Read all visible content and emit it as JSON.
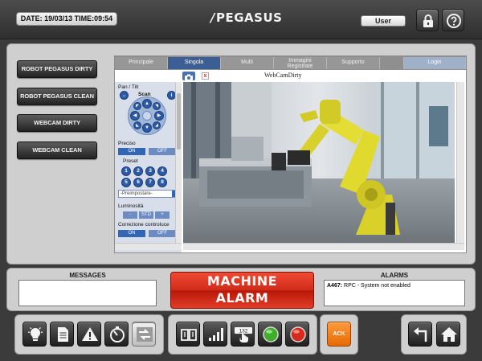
{
  "header": {
    "datetime": "DATE: 19/03/13 TIME:09:54",
    "brand": "PEGASUS",
    "user": "User",
    "lock_icon": "lock-icon",
    "help_icon": "help-icon"
  },
  "sidebar": {
    "buttons": [
      {
        "label": "ROBOT PEGASUS DIRTY"
      },
      {
        "label": "ROBOT PEGASUS CLEAN"
      },
      {
        "label": "WEBCAM DIRTY"
      },
      {
        "label": "WEBCAM CLEAN"
      }
    ]
  },
  "browser": {
    "tabs": [
      {
        "label": "Principale"
      },
      {
        "label": "Singola"
      },
      {
        "label": "Multi"
      },
      {
        "label": "Immagini",
        "label2": "Registrate"
      },
      {
        "label": "Supporto"
      },
      {
        "label": "Login"
      }
    ],
    "active_tab": "Singola",
    "cam_title": "WebCamDirty",
    "controls": {
      "pan_tilt": "Pan / Tilt",
      "scan": "Scan",
      "preciso": "Preciso",
      "on": "ON",
      "off": "OFF",
      "preset": "Preset",
      "presets": [
        "1",
        "2",
        "3",
        "4",
        "5",
        "6",
        "7",
        "8"
      ],
      "preset_select": "-Preimpostare-",
      "luminosita": "Luminosità",
      "minus": "-",
      "std": "STD",
      "plus": "+",
      "correzione": "Correzione controluce"
    }
  },
  "messages": {
    "title": "MESSAGES",
    "text": ""
  },
  "alarm_banner": {
    "line1": "MACHINE",
    "line2": "ALARM",
    "color": "#d8301c"
  },
  "alarms": {
    "title": "ALARMS",
    "code": "A467:",
    "text": " RPC - System not enabled"
  },
  "toolbar": {
    "left": [
      "lightbulb-icon",
      "document-icon",
      "warning-icon",
      "stopwatch-icon",
      "transfer-icon"
    ],
    "middle": [
      "book-icon",
      "signal-bars-icon",
      "counter-hand-icon",
      "green-light-icon",
      "red-light-icon"
    ],
    "counter_label": "132",
    "ack_label": "ACK",
    "right": [
      "back-arrow-icon",
      "home-icon"
    ]
  }
}
